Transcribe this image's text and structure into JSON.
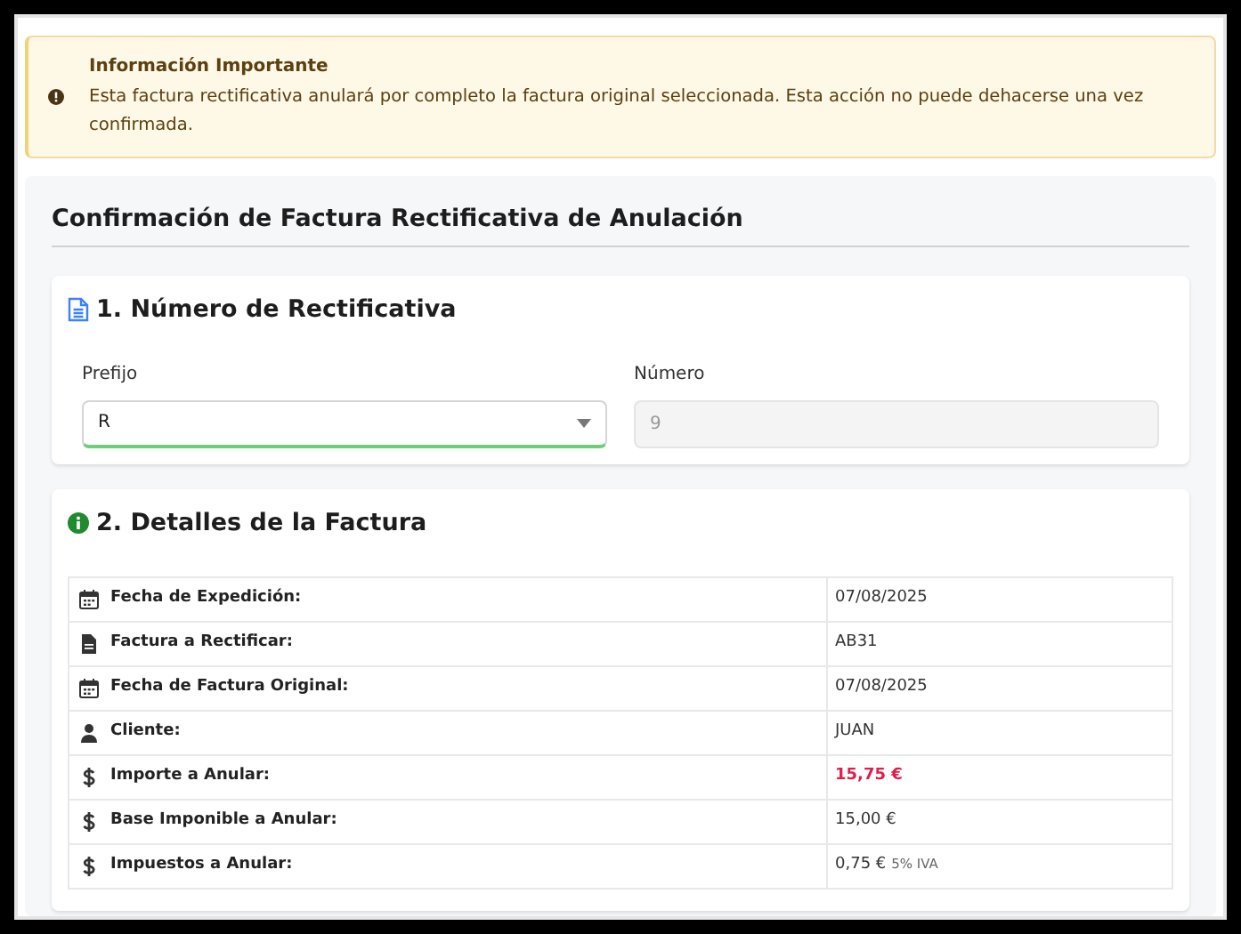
{
  "alert": {
    "title": "Información Importante",
    "message": "Esta factura rectificativa anulará por completo la factura original seleccionada. Esta acción no puede dehacerse una vez confirmada."
  },
  "page_title": "Confirmación de Factura Rectificativa de Anulación",
  "section_number": {
    "title": "1. Número de Rectificativa",
    "fields": [
      {
        "kind": "select",
        "label": "Prefijo",
        "value": "R",
        "valid": true,
        "disabled": false
      },
      {
        "kind": "input",
        "label": "Número",
        "value": "9",
        "valid": false,
        "disabled": true
      }
    ]
  },
  "section_details": {
    "title": "2. Detalles de la Factura",
    "rows": [
      {
        "kind": "calendar",
        "label": "Fecha de Expedición:",
        "value": "07/08/2025",
        "highlight": false
      },
      {
        "kind": "file",
        "label": "Factura a Rectificar:",
        "value": "AB31",
        "highlight": false
      },
      {
        "kind": "calendar",
        "label": "Fecha de Factura Original:",
        "value": "07/08/2025",
        "highlight": false
      },
      {
        "kind": "user",
        "label": "Cliente:",
        "value": "JUAN",
        "highlight": false
      },
      {
        "kind": "dollar",
        "label": "Importe a Anular:",
        "value": "15,75 €",
        "highlight": true
      },
      {
        "kind": "dollar",
        "label": "Base Imponible a Anular:",
        "value": "15,00 €",
        "highlight": false
      },
      {
        "kind": "dollar",
        "label": "Impuestos a Anular:",
        "value": "0,75 €",
        "note": "5% IVA",
        "highlight": false
      }
    ]
  }
}
